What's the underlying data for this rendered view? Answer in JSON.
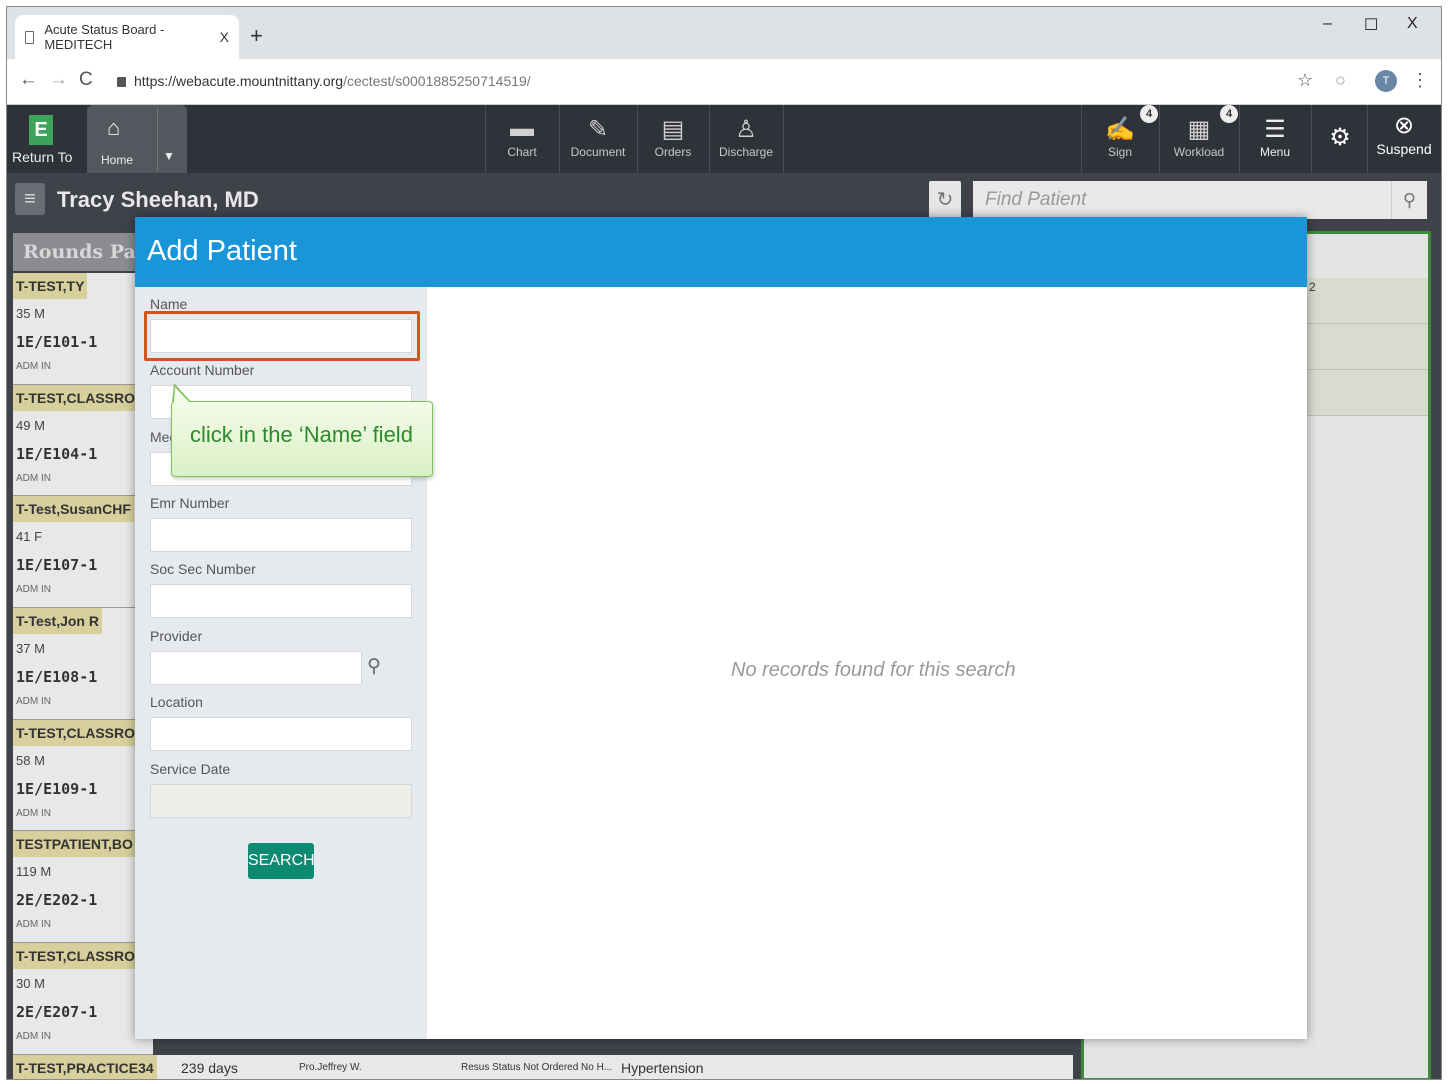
{
  "browser": {
    "tab_title": "Acute Status Board - MEDITECH",
    "tab_close": "X",
    "new_tab": "+",
    "minimize": "–",
    "maximize": "☐",
    "close": "X",
    "url_host": "https://webacute.mountnittany.org",
    "url_path": "/cectest/s0001885250714519/",
    "profile_initial": "T"
  },
  "toolbar": {
    "return_label": "Return To",
    "return_glyph": "E",
    "home_label": "Home",
    "chart_label": "Chart",
    "document_label": "Document",
    "orders_label": "Orders",
    "discharge_label": "Discharge",
    "sign_label": "Sign",
    "sign_badge": "4",
    "workload_label": "Workload",
    "workload_badge": "4",
    "menu_label": "Menu",
    "suspend_label": "Suspend"
  },
  "header": {
    "user_name": "Tracy Sheehan, MD",
    "find_patient_placeholder": "Find Patient"
  },
  "board": {
    "rounds_title": "Rounds Patie",
    "patients": [
      {
        "name": "T-TEST,TY",
        "age": "35 M",
        "room": "1E/E101-1",
        "status": "ADM IN"
      },
      {
        "name": "T-TEST,CLASSRO",
        "age": "49 M",
        "room": "1E/E104-1",
        "status": "ADM IN"
      },
      {
        "name": "T-Test,SusanCHF",
        "age": "41 F",
        "room": "1E/E107-1",
        "status": "ADM IN"
      },
      {
        "name": "T-Test,Jon R",
        "age": "37 M",
        "room": "1E/E108-1",
        "status": "ADM IN"
      },
      {
        "name": "T-TEST,CLASSRO",
        "age": "58 M",
        "room": "1E/E109-1",
        "status": "ADM IN"
      },
      {
        "name": "TESTPATIENT,BO",
        "age": "119 M",
        "room": "2E/E202-1",
        "status": "ADM IN"
      },
      {
        "name": "T-TEST,CLASSRO",
        "age": "30 M",
        "room": "2E/E207-1",
        "status": "ADM IN"
      }
    ],
    "bottom_row": {
      "name": "T-TEST,PRACTICE34",
      "days": "239 days",
      "provider": "Pro.Jeffrey W.",
      "resus": "Resus Status Not Ordered No H...",
      "problem": "Hypertension"
    },
    "right_panel_peek": "2"
  },
  "modal": {
    "title": "Add Patient",
    "name_label": "Name",
    "account_label": "Account Number",
    "med_label": "Med",
    "emr_label": "Emr Number",
    "ssn_label": "Soc Sec Number",
    "provider_label": "Provider",
    "location_label": "Location",
    "service_date_label": "Service Date",
    "search_label": "SEARCH",
    "no_records": "No records found for this search"
  },
  "callout": {
    "text": "click in the ‘Name’ field"
  },
  "colors": {
    "modal_header": "#1a96d8",
    "search_button": "#0f8a72",
    "highlight": "#d8501a",
    "callout_text": "#2d8a2d",
    "patient_name_bg": "#d7d09c"
  }
}
